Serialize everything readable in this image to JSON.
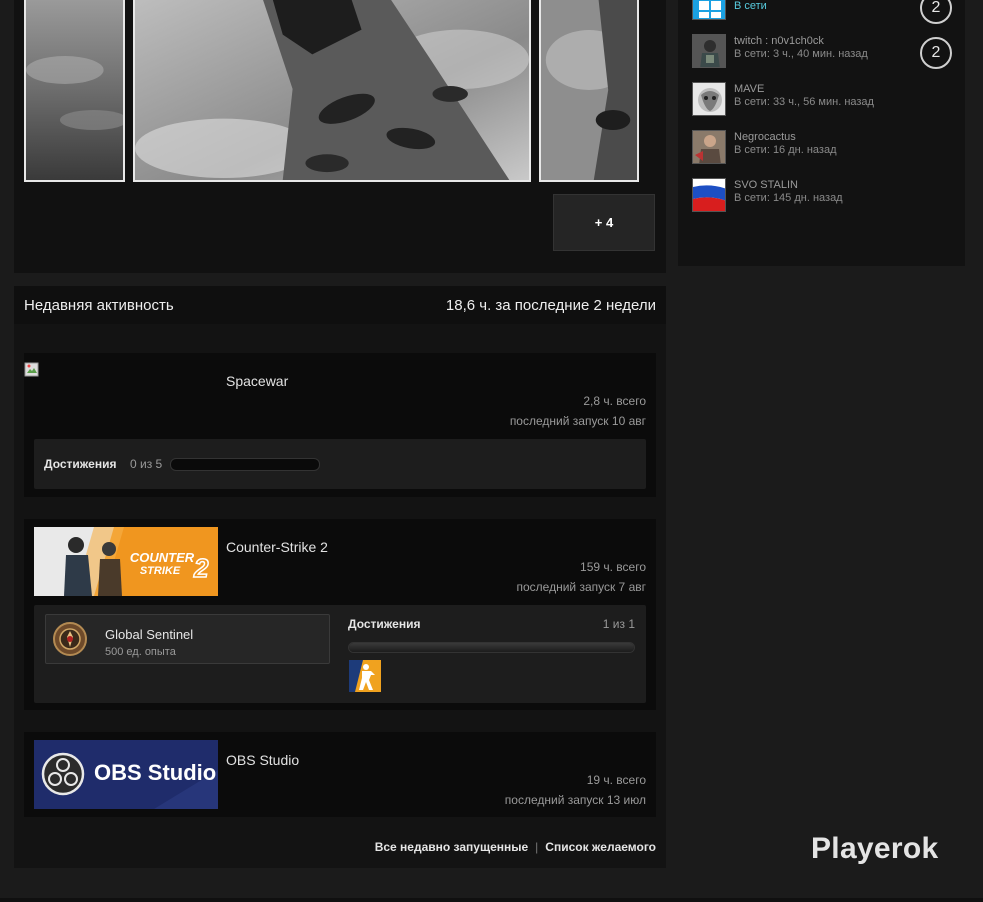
{
  "screenshots": {
    "more_label": "+ 4"
  },
  "friends": [
    {
      "name": "",
      "status": "В сети",
      "online": true,
      "count": "2"
    },
    {
      "name": "twitch : n0v1ch0ck",
      "status": "В сети: 3 ч., 40 мин. назад",
      "online": false,
      "count": "2"
    },
    {
      "name": "MAVE",
      "status": "В сети: 33 ч., 56 мин. назад",
      "online": false
    },
    {
      "name": "Negrocactus",
      "status": "В сети: 16 дн. назад",
      "online": false
    },
    {
      "name": "SVO STALIN",
      "status": "В сети: 145 дн. назад",
      "online": false
    }
  ],
  "activity": {
    "title": "Недавняя активность",
    "hours_summary": "18,6 ч. за последние 2 недели",
    "games": [
      {
        "name": "Spacewar",
        "hours": "2,8 ч. всего",
        "last_played": "последний запуск 10 авг",
        "achievements_label": "Достижения",
        "achievements_count": "0 из 5",
        "progress": 0
      },
      {
        "name": "Counter-Strike 2",
        "capsule_text_1": "COUNTER",
        "capsule_text_2": "STRIKE",
        "capsule_text_3": "2",
        "hours": "159 ч. всего",
        "last_played": "последний запуск 7 авг",
        "badge_title": "Global Sentinel",
        "badge_xp": "500 ед. опыта",
        "achievements_label": "Достижения",
        "achievements_count": "1 из 1",
        "progress": 1
      },
      {
        "name": "OBS Studio",
        "capsule_text": "OBS Studio",
        "hours": "19 ч. всего",
        "last_played": "последний запуск 13 июл"
      }
    ],
    "links": {
      "recent": "Все недавно запущенные",
      "separator": "|",
      "wishlist": "Список желаемого"
    }
  },
  "watermark": "Playerok",
  "colors": {
    "online": "#57cbde",
    "cs2_orange": "#f0961f",
    "obs_blue": "#1f2c6b"
  }
}
